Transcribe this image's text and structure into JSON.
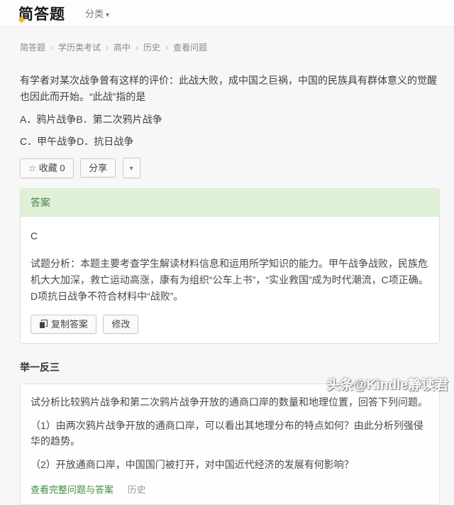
{
  "header": {
    "logo": "简答题",
    "category_label": "分类"
  },
  "icons": {
    "caret_down": "▾",
    "star": "☆"
  },
  "breadcrumb": {
    "separator": "›",
    "items": [
      "简答题",
      "学历类考试",
      "高中",
      "历史",
      "查看问题"
    ]
  },
  "question": {
    "text": "有学者对某次战争曾有这样的评价：此战大败，成中国之巨祸，中国的民族具有群体意义的觉醒也因此而开始。“此战”指的是",
    "option_line1": "A．鸦片战争B．第二次鸦片战争",
    "option_line2": "C．甲午战争D．抗日战争"
  },
  "actions": {
    "favorite_label": "收藏",
    "favorite_count": "0",
    "share_label": "分享"
  },
  "answer_panel": {
    "title": "答案",
    "answer": "C",
    "analysis": "试题分析：本题主要考查学生解读材料信息和运用所学知识的能力。甲午战争战败，民族危机大大加深，救亡运动高涨，康有为组织“公车上书”，“实业救国”成为时代潮流，C项正确。D项抗日战争不符合材料中“战败”。",
    "copy_label": "复制答案",
    "edit_label": "修改"
  },
  "related": {
    "heading": "举一反三",
    "intro": "试分析比较鸦片战争和第二次鸦片战争开放的通商口岸的数量和地理位置，回答下列问题。",
    "q1": "（1）由两次鸦片战争开放的通商口岸，可以看出其地理分布的特点如何？由此分析列强侵华的趋势。",
    "q2": "（2）开放通商口岸，中国国门被打开，对中国近代经济的发展有何影响？",
    "view_full_label": "查看完整问题与答案",
    "tag": "历史"
  },
  "watermark": "头条@Kindle静读君",
  "colors": {
    "accent_green": "#3e8f3e",
    "panel_header_bg": "#dff0d8",
    "panel_header_text": "#4c7e4c",
    "panel_border": "#d6e9c6",
    "logo_accent": "#f0b915"
  }
}
